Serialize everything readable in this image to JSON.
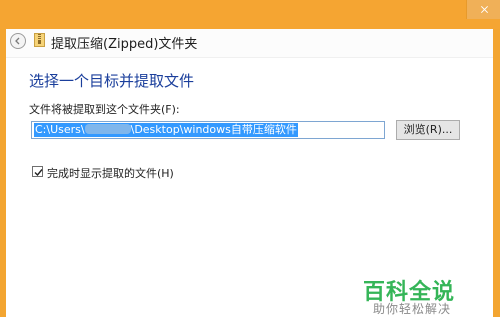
{
  "window": {
    "title": "提取压缩(Zipped)文件夹",
    "close_icon": "close-icon",
    "back_icon": "back-arrow-icon",
    "folder_icon": "zip-folder-icon"
  },
  "dialog": {
    "heading": "选择一个目标并提取文件",
    "path_label": "文件将被提取到这个文件夹(F):",
    "path_value_prefix": "C:\\Users\\",
    "path_value_suffix": "\\Desktop\\windows自带压缩软件",
    "browse_label": "浏览(R)...",
    "show_files_label": "完成时显示提取的文件(H)",
    "show_files_checked": true
  },
  "watermark": {
    "title": "百科全说",
    "subtitle": "助你轻松解决"
  },
  "colors": {
    "accent": "#f5a532",
    "heading": "#1b3f9c",
    "selection": "#3399ff",
    "watermark_green": "#35b558"
  }
}
